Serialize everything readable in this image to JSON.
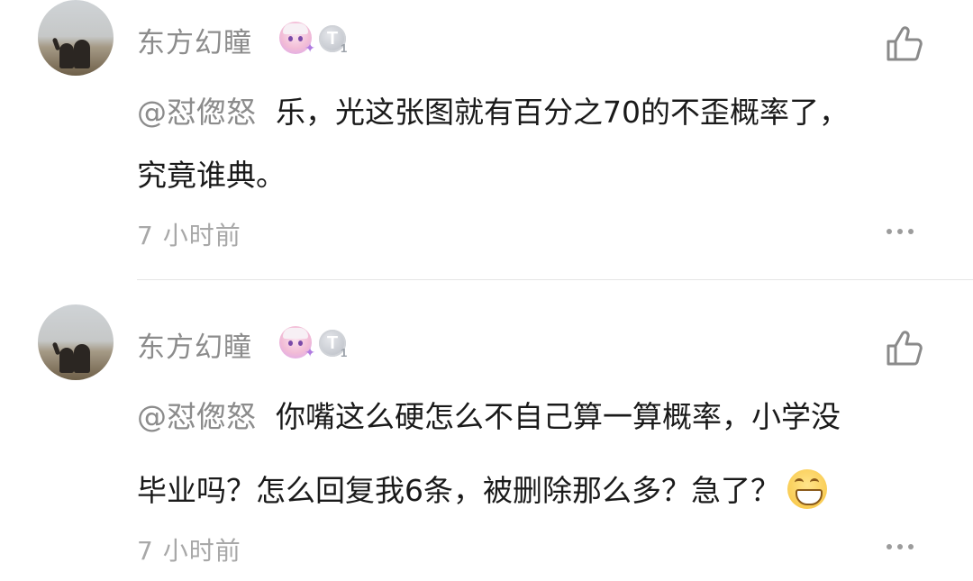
{
  "comments": [
    {
      "username": "东方幻瞳",
      "badge_level": "1",
      "mention": "@怼偬怒",
      "lines": [
        "乐，光这张图就有百分之70的不歪概率了，",
        "究竟谁典。"
      ],
      "time": "7 小时前"
    },
    {
      "username": "东方幻瞳",
      "badge_level": "1",
      "mention": "@怼偬怒",
      "lines": [
        "你嘴这么硬怎么不自己算一算概率，小学没",
        "毕业吗？怎么回复我6条，被删除那么多？急了？"
      ],
      "time": "7 小时前",
      "emoji": "grinning-emoji"
    }
  ],
  "icons": {
    "like": "thumbs-up-icon",
    "more": "more-dots-icon"
  },
  "colors": {
    "username": "#8c8c8c",
    "text": "#1a1a1a",
    "time": "#a8a8a8"
  }
}
